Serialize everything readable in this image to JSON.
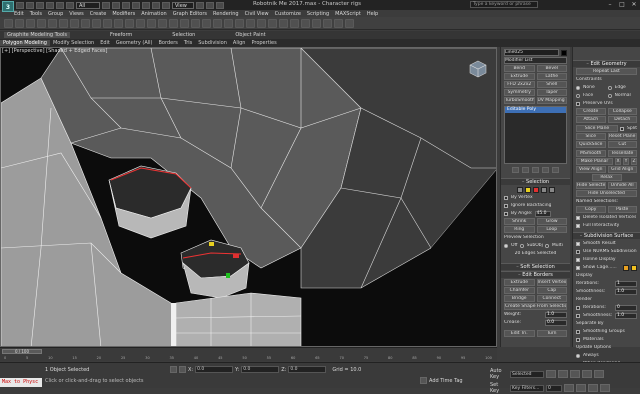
{
  "app": {
    "logo_text": "3",
    "window_title": "Robotnik Me 2017.max - Character rigs",
    "search_placeholder": "Type a keyword or phrase",
    "workspace": "Default"
  },
  "quick_access": {
    "workspace_select": "All",
    "view_select": "View"
  },
  "window_controls": {
    "minimize": "–",
    "maximize": "□",
    "close": "✕"
  },
  "menu": [
    "Edit",
    "Tools",
    "Group",
    "Views",
    "Create",
    "Modifiers",
    "Animation",
    "Graph Editors",
    "Rendering",
    "Civil View",
    "Customize",
    "Scripting",
    "MAXScript",
    "Help"
  ],
  "ribbon": {
    "title": "Graphite Modeling Tools",
    "groups": [
      "Freeform",
      "Selection",
      "Object Paint"
    ],
    "tabs": [
      "Polygon Modeling",
      "Modify Selection",
      "Edit",
      "Geometry (All)",
      "Borders",
      "Tris",
      "Subdivision",
      "Align",
      "Properties"
    ]
  },
  "viewport": {
    "label": "[+] [Perspective] [Shaded + Edged Faces]"
  },
  "command_panel": {
    "object_name": "Line025",
    "modifier_list": "Modifier List",
    "mod_buttons": [
      [
        "Bend",
        "Bevel"
      ],
      [
        "Extrude",
        "Lathe"
      ],
      [
        "FFD 2x2x2",
        "Shell"
      ],
      [
        "Symmetry",
        "Taper"
      ],
      [
        "TurboSmooth",
        "UV Mapping Cle"
      ]
    ],
    "stack_item": "Editable Poly",
    "selection_head": "Selection",
    "by_vertex": "By Vertex",
    "ignore_backfacing": "Ignore Backfacing",
    "by_angle": "By Angle:",
    "by_angle_value": "45.0",
    "shrink": "Shrink",
    "grow": "Grow",
    "ring": "Ring",
    "loop": "Loop",
    "preview_selection": "Preview Selection",
    "preview_off": "Off",
    "preview_subobj": "SubObj",
    "preview_multi": "Multi",
    "selected_count": "20 Edges Selected",
    "soft_selection": "Soft Selection",
    "edit_borders": "Edit Borders",
    "extrude": "Extrude",
    "insert_vertex": "Insert Vertex",
    "chamfer": "Chamfer",
    "cap": "Cap",
    "bridge": "Bridge",
    "connect": "Connect",
    "create_shape": "Create Shape From Selection",
    "weight_label": "Weight:",
    "weight_value": "1.0",
    "crease_label": "Crease:",
    "crease_value": "0.0",
    "edit_tri": "Edit Tri.",
    "turn": "Turn"
  },
  "right_panel": {
    "edit_geometry": "Edit Geometry",
    "repeat_last": "Repeat Last",
    "constraints": "Constraints",
    "c_none": "None",
    "c_edge": "Edge",
    "c_face": "Face",
    "c_normal": "Normal",
    "preserve_uvs": "Preserve UVs",
    "create": "Create",
    "collapse": "Collapse",
    "attach": "Attach",
    "detach": "Detach",
    "slice_plane": "Slice Plane",
    "split": "Split",
    "slice": "Slice",
    "reset_plane": "Reset Plane",
    "quickslice": "QuickSlice",
    "cut": "Cut",
    "msmooth": "MSmooth",
    "tessellate": "Tessellate",
    "make_planar": "Make Planar",
    "x": "X",
    "y": "Y",
    "z": "Z",
    "view_align": "View Align",
    "grid_align": "Grid Align",
    "relax": "Relax",
    "hide_selected": "Hide Selected",
    "unhide_all": "Unhide All",
    "hide_unselected": "Hide Unselected",
    "named_selections": "Named Selections:",
    "copy": "Copy",
    "paste": "Paste",
    "delete_isolated": "Delete Isolated Vertices",
    "full_interactivity": "Full Interactivity",
    "subdivision_surface": "Subdivision Surface",
    "smooth_result": "Smooth Result",
    "use_nurms": "Use NURMS Subdivision",
    "isoline_display": "Isoline Display",
    "show_cage": "Show Cage......",
    "cage_color_1": "#e8a020",
    "cage_color_2": "#f0c020",
    "display": "Display",
    "iterations_label": "Iterations:",
    "iterations_value": "1",
    "smoothness_label": "Smoothness:",
    "smoothness_value": "1.0",
    "render": "Render",
    "r_iterations_value": "0",
    "r_smoothness_value": "1.0",
    "separate_by": "Separate By",
    "smoothing_groups": "Smoothing Groups",
    "materials": "Materials",
    "update_options": "Update Options",
    "always": "Always",
    "when_rendering": "When Rendering",
    "manually": "Manually"
  },
  "timeline": {
    "slider": "0 / 100",
    "ticks": [
      "0",
      "5",
      "10",
      "15",
      "20",
      "25",
      "30",
      "35",
      "40",
      "45",
      "50",
      "55",
      "60",
      "65",
      "70",
      "75",
      "80",
      "85",
      "90",
      "95",
      "100"
    ]
  },
  "status": {
    "maxscript": "Max to Physc",
    "line1": "1 Object Selected",
    "line2": "Click or click-and-drag to select objects",
    "x_label": "X:",
    "x_value": "0.0",
    "y_label": "Y:",
    "y_value": "0.0",
    "z_label": "Z:",
    "z_value": "0.0",
    "grid": "Grid = 10.0",
    "add_time_tag": "Add Time Tag",
    "auto_key": "Auto Key",
    "set_key": "Set Key",
    "selected": "Selected",
    "key_filters": "Key Filters...",
    "frame": "0"
  }
}
